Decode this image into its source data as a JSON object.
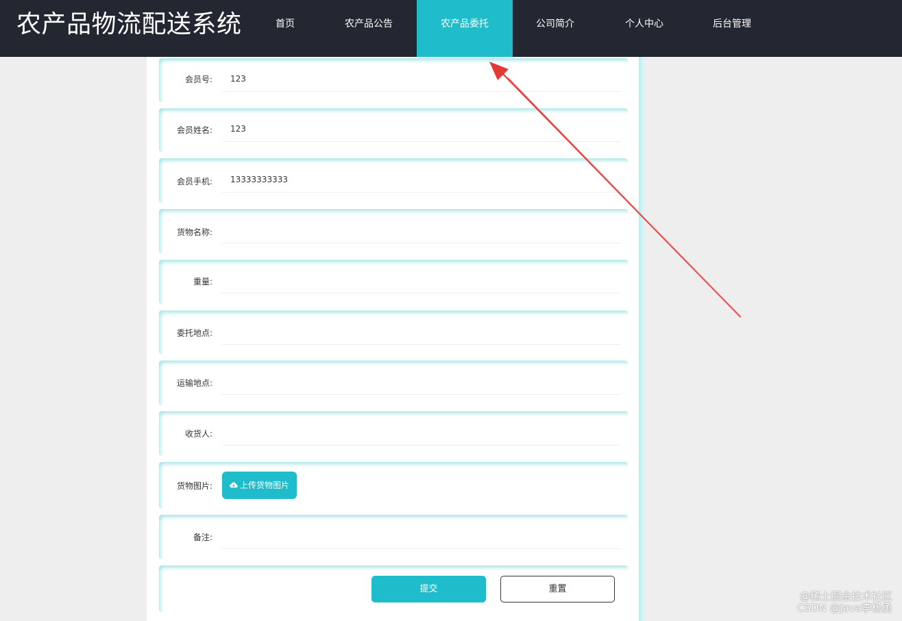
{
  "header": {
    "site_title": "农产品物流配送系统",
    "nav": [
      {
        "label": "首页",
        "active": false
      },
      {
        "label": "农产品公告",
        "active": false
      },
      {
        "label": "农产品委托",
        "active": true
      },
      {
        "label": "公司简介",
        "active": false
      },
      {
        "label": "个人中心",
        "active": false
      },
      {
        "label": "后台管理",
        "active": false
      }
    ]
  },
  "form": {
    "fields": [
      {
        "label": "会员号:",
        "value": "123"
      },
      {
        "label": "会员姓名:",
        "value": "123"
      },
      {
        "label": "会员手机:",
        "value": "13333333333"
      },
      {
        "label": "货物名称:",
        "value": ""
      },
      {
        "label": "重量:",
        "value": ""
      },
      {
        "label": "委托地点:",
        "value": ""
      },
      {
        "label": "运输地点:",
        "value": ""
      },
      {
        "label": "收货人:",
        "value": ""
      },
      {
        "label": "货物图片:",
        "upload_label": "上传货物图片"
      },
      {
        "label": "备注:",
        "value": ""
      }
    ],
    "submit_label": "提交",
    "reset_label": "重置"
  },
  "watermark": {
    "line1": "@稀土掘金技术社区",
    "line2": "CSDN @java李杨勇"
  },
  "colors": {
    "header_bg": "#232731",
    "accent": "#1fbccb",
    "annotation_arrow": "#e53935"
  }
}
